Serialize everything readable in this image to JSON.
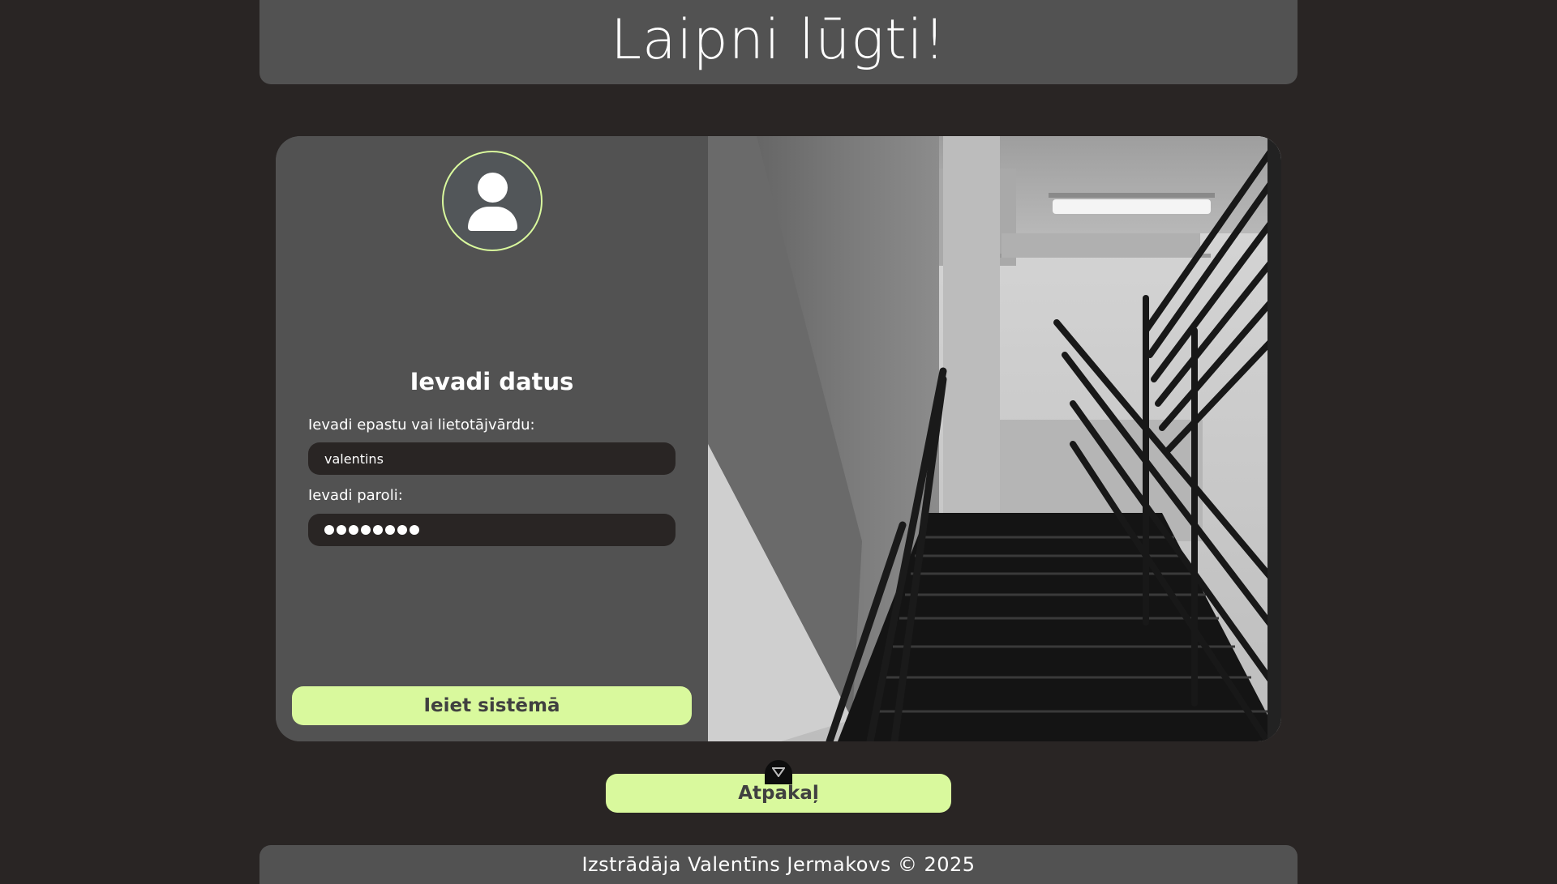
{
  "header": {
    "title": "Laipni lūgti!"
  },
  "login": {
    "heading": "Ievadi datus",
    "username_label": "Ievadi epastu vai lietotājvārdu:",
    "username_value": "valentins",
    "password_label": "Ievadi paroli:",
    "password_length": 8,
    "submit_label": "Ieiet sistēmā"
  },
  "back_button": {
    "label": "Atpakaļ"
  },
  "footer": {
    "text": "Izstrādāja Valentīns Jermakovs © 2025"
  },
  "colors": {
    "page_background": "#292524",
    "panel_background": "#525252",
    "accent": "#d9f99d",
    "input_background": "#292524"
  },
  "icons": {
    "avatar": "user-icon",
    "devtools": "chevron-down-icon"
  }
}
